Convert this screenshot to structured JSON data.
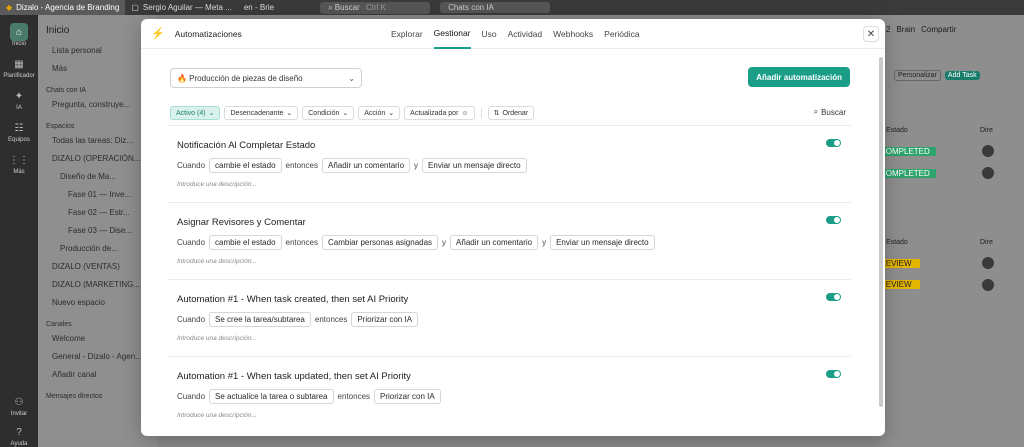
{
  "browser": {
    "tabs": [
      {
        "label": "Dizalo - Agencia de Branding",
        "active": true
      },
      {
        "label": "Sergio Aguilar — Meta ...",
        "active": false
      },
      {
        "label": "en - Brie",
        "active": false
      }
    ],
    "search_placeholder": "Buscar",
    "search_shortcut": "Ctrl K",
    "chat_label": "Chats con IA"
  },
  "rail": [
    {
      "label": "Inicio",
      "icon": "home-icon"
    },
    {
      "label": "Planificador",
      "icon": "calendar-icon"
    },
    {
      "label": "IA",
      "icon": "ai-icon"
    },
    {
      "label": "Equipos",
      "icon": "team-icon"
    },
    {
      "label": "Más",
      "icon": "grid-icon"
    },
    {
      "label": "Invitar",
      "icon": "user-add-icon"
    },
    {
      "label": "Ayuda",
      "icon": "help-icon"
    }
  ],
  "sidebar": {
    "title": "Inicio",
    "items": [
      "Lista personal",
      "Más"
    ],
    "chat_section": "Chats con IA",
    "chat_prompt": "Pregunta, construye...",
    "spaces_section": "Espacios",
    "spaces": [
      "Todas las tareas: Diz...",
      "DIZALO (OPERACIÓN...",
      "Diseño de Ma...",
      "Fase 01 — Inve...",
      "Fase 02 — Estr...",
      "Fase 03 — Dise...",
      "Producción de...",
      "DIZALO (VENTAS)",
      "DIZALO (MARKETING...",
      "Nuevo espacio"
    ],
    "channels_section": "Canales",
    "channels": [
      "Welcome",
      "General - Dizalo - Agen...",
      "Añadir canal"
    ],
    "dm_section": "Mensajes directos"
  },
  "right_panel": {
    "toolbar": [
      "2",
      "Brain",
      "Compartir"
    ],
    "customize": "Personalizar",
    "add_task": "Add Task",
    "col_status": "Estado",
    "col_owner": "Dire",
    "status_completed": "COMPLETED",
    "status_review": "REVIEW"
  },
  "modal": {
    "title": "Automatizaciones",
    "tabs": [
      "Explorar",
      "Gestionar",
      "Uso",
      "Actividad",
      "Webhooks",
      "Periódica"
    ],
    "active_tab": "Gestionar",
    "select_value": "🔥 Producción de piezas de diseño",
    "add_button": "Añadir automatización",
    "filters": {
      "active": "Activo (4)",
      "trigger": "Desencadenante",
      "condition": "Condición",
      "action": "Acción",
      "updated": "Actualizada por",
      "sort": "Ordenar",
      "search": "Buscar"
    },
    "desc_placeholder": "Introduce una descripción...",
    "rules": [
      {
        "title": "Notificación Al Completar Estado",
        "when": "Cuando",
        "trigger": "cambie el estado",
        "then": "entonces",
        "actions": [
          "Añadir un comentario",
          "Enviar un mensaje directo"
        ],
        "join": "y",
        "enabled": true
      },
      {
        "title": "Asignar Revisores y Comentar",
        "when": "Cuando",
        "trigger": "cambie el estado",
        "then": "entonces",
        "actions": [
          "Cambiar personas asignadas",
          "Añadir un comentario",
          "Enviar un mensaje directo"
        ],
        "join": "y",
        "enabled": true
      },
      {
        "title": "Automation #1 - When task created, then set AI Priority",
        "when": "Cuando",
        "trigger": "Se cree la tarea/subtarea",
        "then": "entonces",
        "actions": [
          "Priorizar con IA"
        ],
        "join": "y",
        "enabled": true
      },
      {
        "title": "Automation #1 - When task updated, then set AI Priority",
        "when": "Cuando",
        "trigger": "Se actualice la tarea o subtarea",
        "then": "entonces",
        "actions": [
          "Priorizar con IA"
        ],
        "join": "y",
        "enabled": true
      }
    ]
  },
  "colors": {
    "accent": "#1a9e88",
    "completed": "#2ea36b",
    "review": "#e3b400"
  }
}
